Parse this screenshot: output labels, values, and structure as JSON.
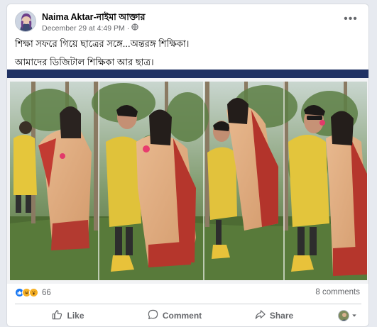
{
  "post": {
    "author": "Naima Aktar-নাইমা আক্তার",
    "timestamp": "December 29 at 4:49 PM",
    "audience_icon": "globe-icon",
    "more_label": "•••",
    "text_lines": [
      "শিক্ষা সফরে গিয়ে ছাত্রের সঙ্গে...অন্তরঙ্গ শিক্ষিকা।",
      "আমাদের ডিজিটাল শিক্ষিকা আর ছাত্র।"
    ]
  },
  "stats": {
    "reaction_icons": [
      "like-reaction-icon",
      "haha-reaction-icon",
      "wow-reaction-icon"
    ],
    "reactions_count": "66",
    "comments_count": "8 comments"
  },
  "actions": {
    "like": "Like",
    "comment": "Comment",
    "share": "Share"
  },
  "colors": {
    "accent_bar": "#1f3163",
    "like_blue": "#1877f2",
    "reaction_yellow": "#f7b125",
    "text_secondary": "#65676b"
  }
}
